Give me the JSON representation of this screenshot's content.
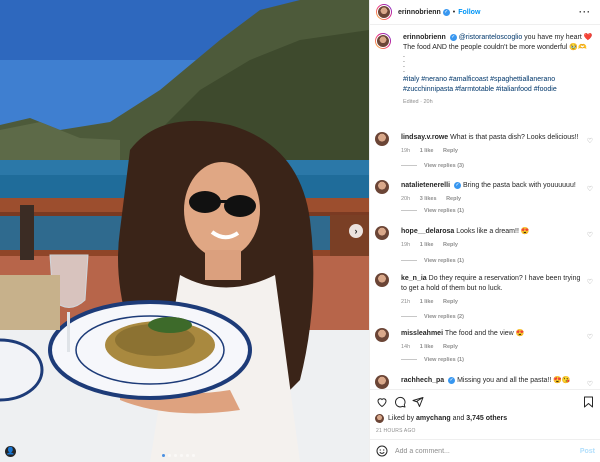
{
  "post": {
    "username": "erinnobrienn",
    "follow_label": "Follow",
    "more_icon": "more-horizontal-icon",
    "image_count": 6,
    "active_image_index": 0
  },
  "caption": {
    "username": "erinnobrienn",
    "mention": "@ristoranteloscoglio",
    "text": "you have my heart ❤️ The food AND the people couldn't be more wonderful 🥹🫶",
    "dots": [
      ".",
      ".",
      ".",
      "."
    ],
    "hashtags": "#italy #nerano #amalficoast #spaghettiallanerano #zucchinnipasta #farmtotable #italianfood #foodie",
    "edited": "Edited · 20h"
  },
  "comments": [
    {
      "username": "lindsay.v.rowe",
      "text": "What is that pasta dish? Looks delicious!!",
      "time": "19h",
      "likes": "1 like",
      "reply": "Reply",
      "view_replies": "View replies (3)",
      "verified": false
    },
    {
      "username": "natalietenerelli",
      "text": "Bring the pasta back with youuuuuu!",
      "time": "20h",
      "likes": "3 likes",
      "reply": "Reply",
      "view_replies": "View replies (1)",
      "verified": true
    },
    {
      "username": "hope__delarosa",
      "text": "Looks like a dream!! 😍",
      "time": "19h",
      "likes": "1 like",
      "reply": "Reply",
      "view_replies": "View replies (1)",
      "verified": false
    },
    {
      "username": "ke_n_ia",
      "text": "Do they require a reservation? I have been trying to get a hold of them but no luck.",
      "time": "21h",
      "likes": "1 like",
      "reply": "Reply",
      "view_replies": "View replies (2)",
      "verified": false
    },
    {
      "username": "missleahmei",
      "text": "The food and the view 😍",
      "time": "14h",
      "likes": "1 like",
      "reply": "Reply",
      "view_replies": "View replies (1)",
      "verified": false
    },
    {
      "username": "rachhech_pa",
      "text": "Missing you and all the pasta!! 😍😘",
      "time": "",
      "likes": "",
      "reply": "",
      "view_replies": "",
      "verified": true
    }
  ],
  "likes": {
    "prefix": "Liked by",
    "user": "amychang",
    "middle": "and",
    "others": "3,745 others"
  },
  "posted_time": "21 hours ago",
  "add_comment": {
    "placeholder": "Add a comment...",
    "post_label": "Post"
  },
  "colors": {
    "link": "#00376b",
    "follow": "#0095f6",
    "verified": "#3897f0",
    "muted": "#8e8e8e",
    "post_disabled": "#b2dffc"
  }
}
